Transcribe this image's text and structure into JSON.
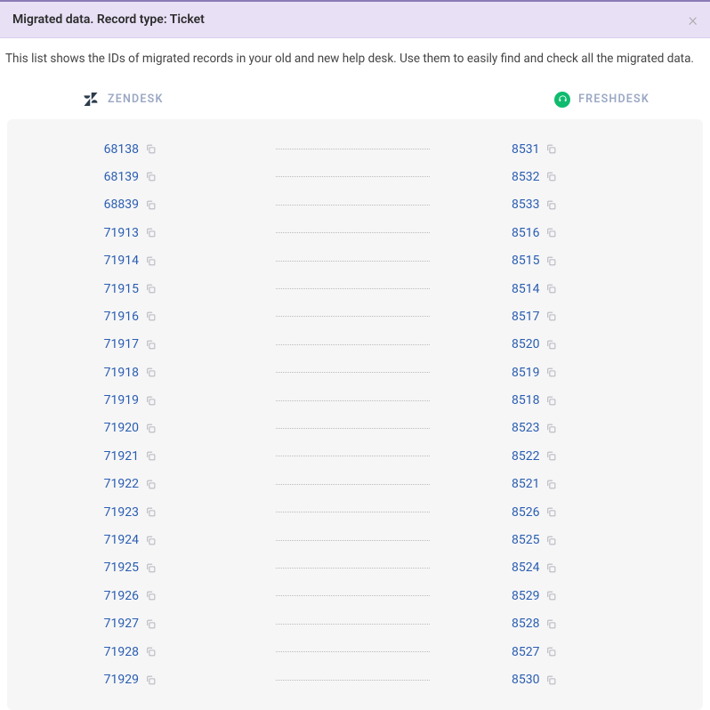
{
  "header": {
    "title": "Migrated data. Record type: Ticket"
  },
  "description": "This list shows the IDs of migrated records in your old and new help desk. Use them to easily find and check all the migrated data.",
  "tabs": {
    "source_label": "ZENDESK",
    "target_label": "FRESHDESK"
  },
  "rows": [
    {
      "source_id": "68138",
      "target_id": "8531"
    },
    {
      "source_id": "68139",
      "target_id": "8532"
    },
    {
      "source_id": "68839",
      "target_id": "8533"
    },
    {
      "source_id": "71913",
      "target_id": "8516"
    },
    {
      "source_id": "71914",
      "target_id": "8515"
    },
    {
      "source_id": "71915",
      "target_id": "8514"
    },
    {
      "source_id": "71916",
      "target_id": "8517"
    },
    {
      "source_id": "71917",
      "target_id": "8520"
    },
    {
      "source_id": "71918",
      "target_id": "8519"
    },
    {
      "source_id": "71919",
      "target_id": "8518"
    },
    {
      "source_id": "71920",
      "target_id": "8523"
    },
    {
      "source_id": "71921",
      "target_id": "8522"
    },
    {
      "source_id": "71922",
      "target_id": "8521"
    },
    {
      "source_id": "71923",
      "target_id": "8526"
    },
    {
      "source_id": "71924",
      "target_id": "8525"
    },
    {
      "source_id": "71925",
      "target_id": "8524"
    },
    {
      "source_id": "71926",
      "target_id": "8529"
    },
    {
      "source_id": "71927",
      "target_id": "8528"
    },
    {
      "source_id": "71928",
      "target_id": "8527"
    },
    {
      "source_id": "71929",
      "target_id": "8530"
    }
  ]
}
